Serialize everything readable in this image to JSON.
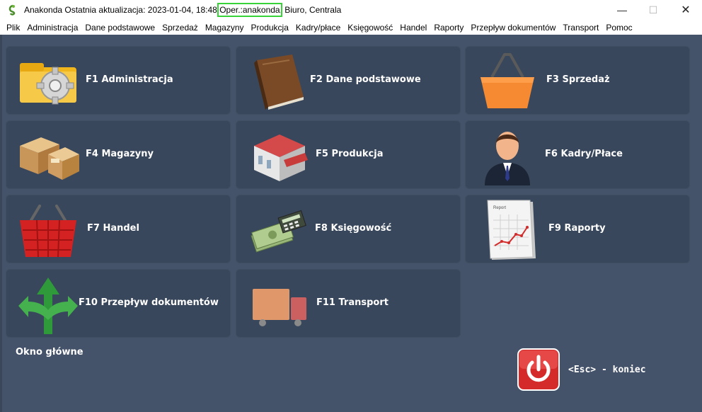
{
  "window": {
    "app_name": "Anakonda",
    "title_prefix": "Anakonda Ostatnia aktualizacja: 2023-01-04, 18:48 ",
    "operator": "Oper.:anakonda",
    "title_suffix": ", Biuro, Centrala",
    "minimize_glyph": "—",
    "maximize_glyph": "☐",
    "close_glyph": "✕"
  },
  "menu": [
    "Plik",
    "Administracja",
    "Dane podstawowe",
    "Sprzedaż",
    "Magazyny",
    "Produkcja",
    "Kadry/płace",
    "Księgowość",
    "Handel",
    "Raporty",
    "Przepływ dokumentów",
    "Transport",
    "Pomoc"
  ],
  "tiles": [
    {
      "label": "F1 Administracja",
      "icon": "gear-folder-icon"
    },
    {
      "label": "F2 Dane podstawowe",
      "icon": "book-icon"
    },
    {
      "label": "F3 Sprzedaż",
      "icon": "shopping-basket-icon"
    },
    {
      "label": "F4 Magazyny",
      "icon": "boxes-icon"
    },
    {
      "label": "F5 Produkcja",
      "icon": "factory-icon"
    },
    {
      "label": "F6 Kadry/Płace",
      "icon": "person-icon"
    },
    {
      "label": "F7 Handel",
      "icon": "red-basket-icon"
    },
    {
      "label": "F8 Księgowość",
      "icon": "money-calculator-icon"
    },
    {
      "label": "F9 Raporty",
      "icon": "report-chart-icon"
    },
    {
      "label": "F10 Przepływ dokumentów",
      "icon": "arrows-icon"
    },
    {
      "label": "F11 Transport",
      "icon": "truck-icon"
    }
  ],
  "report_icon_text": "Report",
  "footer": {
    "window_name": "Okno główne",
    "exit_label": "<Esc> - koniec",
    "exit_icon": "power-icon"
  },
  "colors": {
    "background": "#45536a",
    "tile": "#38475b",
    "highlight": "#38d338",
    "exit_red": "#d42a2a"
  }
}
